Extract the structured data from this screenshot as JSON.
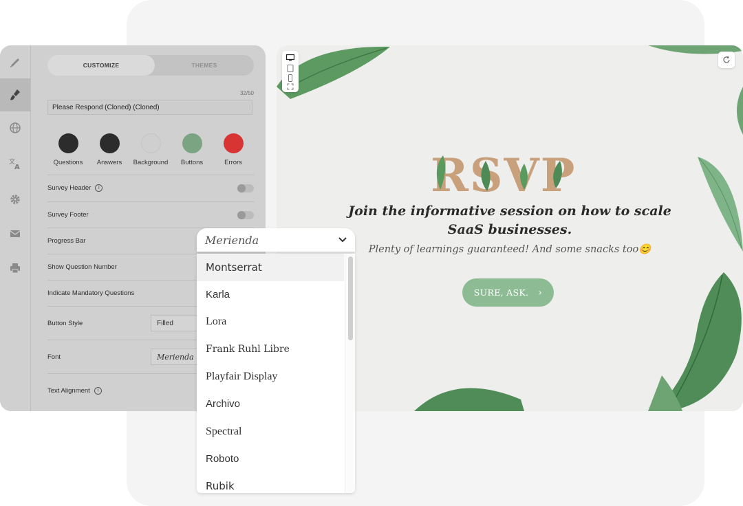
{
  "editor": {
    "tabs": {
      "customize": "CUSTOMIZE",
      "themes": "THEMES"
    },
    "title_counter": "32/50",
    "title_value": "Please Respond (Cloned) (Cloned)",
    "colors": [
      {
        "label": "Questions",
        "color": "#2c2c2c"
      },
      {
        "label": "Answers",
        "color": "#2c2c2c"
      },
      {
        "label": "Background",
        "color": "#cfcfcf"
      },
      {
        "label": "Buttons",
        "color": "#7ba483"
      },
      {
        "label": "Errors",
        "color": "#d83434"
      }
    ],
    "settings": {
      "survey_header": "Survey Header",
      "survey_footer": "Survey Footer",
      "progress_bar": "Progress Bar",
      "show_question_number": "Show Question Number",
      "indicate_mandatory": "Indicate Mandatory Questions",
      "button_style": "Button Style",
      "button_style_value": "Filled",
      "font": "Font",
      "font_value": "Merienda",
      "text_alignment": "Text Alignment"
    }
  },
  "font_dropdown": {
    "selected": "Merienda",
    "options": [
      "Montserrat",
      "Karla",
      "Lora",
      "Frank Ruhl Libre",
      "Playfair Display",
      "Archivo",
      "Spectral",
      "Roboto",
      "Rubik"
    ]
  },
  "preview": {
    "logo_text": "RSVP",
    "headline": "Join the informative session on how to scale SaaS businesses.",
    "subtext": "Plenty of learnings guaranteed! And some snacks too😊",
    "cta_label": "SURE, ASK."
  }
}
